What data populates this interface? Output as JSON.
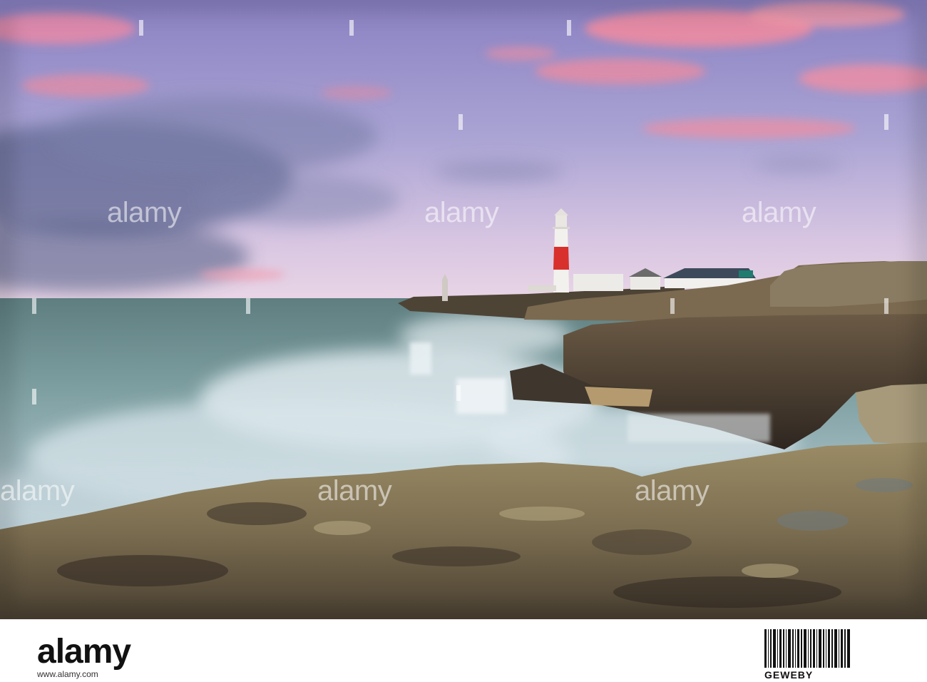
{
  "image": {
    "scene": "lighthouse-coast-long-exposure",
    "colors": {
      "sky_top": "#8e86c6",
      "sky_mid": "#b7b1da",
      "sky_horizon": "#e8d4e6",
      "cloud_pink": "#f08aa0",
      "sea": "#6f8f8e",
      "foam": "#dfe9ef",
      "rock_dark": "#3b332b",
      "rock_light": "#a89a73",
      "lighthouse_red": "#d8302c",
      "lighthouse_white": "#f3f1ee"
    }
  },
  "watermark": {
    "text": "alamy",
    "logo_text": "alamy",
    "stock_id": "GEWEBY",
    "subtext": "www.alamy.com"
  }
}
